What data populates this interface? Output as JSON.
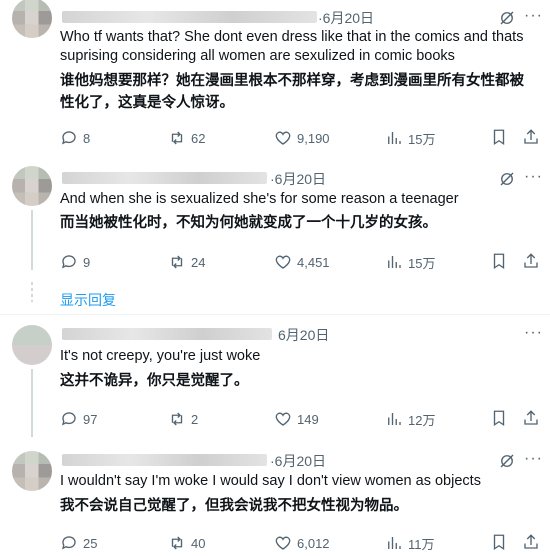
{
  "tweets": [
    {
      "date": "·6月20日",
      "text_en": "Who tf wants that? She dont even dress like that in the comics and thats suprising considering all women are sexulized in comic books",
      "text_zh": "谁他妈想要那样？她在漫画里根本不那样穿，考虑到漫画里所有女性都被性化了，这真是令人惊讶。",
      "replies": "8",
      "retweets": "62",
      "likes": "9,190",
      "views": "15万"
    },
    {
      "date": "·6月20日",
      "text_en": "And when she is sexualized she's for some reason a teenager",
      "text_zh": "而当她被性化时，不知为何她就变成了一个十几岁的女孩。",
      "replies": "9",
      "retweets": "24",
      "likes": "4,451",
      "views": "15万"
    },
    {
      "date": "6月20日",
      "text_en": "It's not creepy, you're just woke",
      "text_zh": "这并不诡异，你只是觉醒了。",
      "replies": "97",
      "retweets": "2",
      "likes": "149",
      "views": "12万"
    },
    {
      "date": "·6月20日",
      "text_en": "I wouldn't say I'm woke I would say I don't view women as objects",
      "text_zh": "我不会说自己觉醒了，但我会说我不把女性视为物品。",
      "replies": "25",
      "retweets": "40",
      "likes": "6,012",
      "views": "11万"
    }
  ],
  "show_replies": "显示回复",
  "icons": [
    "grok-icon",
    "more-icon",
    "reply-icon",
    "retweet-icon",
    "like-icon",
    "views-icon",
    "bookmark-icon",
    "share-icon"
  ]
}
